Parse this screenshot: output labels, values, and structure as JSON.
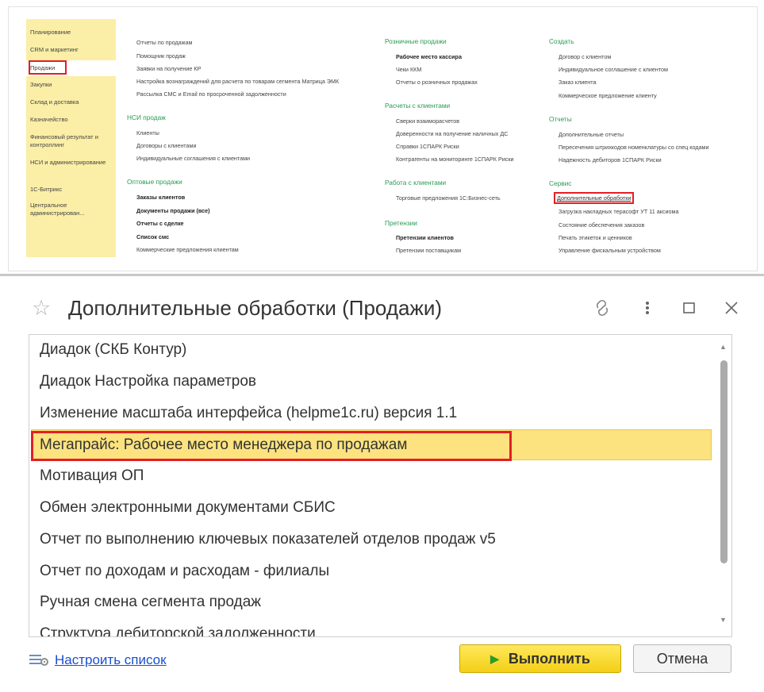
{
  "sidebar": {
    "items": [
      "Планирование",
      "CRM и маркетинг",
      "Продажи",
      "Закупки",
      "Склад и доставка",
      "Казначейство",
      "Финансовый результат и контроллинг",
      "НСИ и администрирование",
      "1С-Битрикс",
      "Центральное администрирован..."
    ]
  },
  "col1": {
    "links": [
      "Отчеты по продажам",
      "Помощник продаж",
      "Заявки на получение КР",
      "Настройка вознаграждений для расчета по товарам сегмента Матрица ЭМК",
      "Рассылка СМС и Email по просроченной задолженности"
    ],
    "nsi_title": "НСИ продаж",
    "nsi_links": [
      "Клиенты",
      "Договоры с клиентами",
      "Индивидуальные соглашения с клиентами"
    ],
    "opt_title": "Оптовые продажи",
    "opt_links": [
      "Заказы клиентов",
      "Документы продажи (все)",
      "Отчеты с сделке",
      "Список смс",
      "Коммерческие предложения клиентам"
    ]
  },
  "col2": {
    "retail_title": "Розничные продажи",
    "retail_links": [
      "Рабочее место кассира",
      "Чеки ККМ",
      "Отчеты о розничных продажах"
    ],
    "calc_title": "Расчеты с клиентами",
    "calc_links": [
      "Сверки взаиморасчетов",
      "Доверенности на получение наличных ДС",
      "Справки 1СПАРК Риски",
      "Контрагенты на мониторинге 1СПАРК Риски"
    ],
    "work_title": "Работа с клиентами",
    "work_links": [
      "Торговые предложения 1С:Бизнес-сеть"
    ],
    "claims_title": "Претензии",
    "claims_links": [
      "Претензии клиентов",
      "Претензии поставщикам"
    ]
  },
  "col3": {
    "create_title": "Создать",
    "create_links": [
      "Договор с клиентом",
      "Индивидуальное соглашение с клиентом",
      "Заказ клиента",
      "Коммерческое предложение клиенту"
    ],
    "reports_title": "Отчеты",
    "reports_links": [
      "Дополнительные отчеты",
      "Пересечения штрихкодов номенклатуры со спец кодами",
      "Надежность дебиторов 1СПАРК Риски"
    ],
    "service_title": "Сервис",
    "service_links": [
      "Дополнительные обработки",
      "Загрузка накладных терасофт УТ 11 аксиома",
      "Состояние обеспечения заказов",
      "Печать этикеток и ценников",
      "Управление фискальным устройством"
    ]
  },
  "dialog": {
    "title": "Дополнительные обработки (Продажи)",
    "items": [
      "Диадок (СКБ Контур)",
      "Диадок Настройка параметров",
      "Изменение масштаба интерфейса (helpme1c.ru) версия 1.1",
      "Мегапрайс: Рабочее место менеджера по продажам",
      "Мотивация ОП",
      "Обмен электронными документами СБИС",
      "Отчет по выполнению ключевых показателей отделов продаж v5",
      "Отчет по доходам и расходам - филиалы",
      "Ручная смена сегмента продаж",
      "Структура дебиторской задолженности"
    ],
    "configure_label": "Настроить список",
    "run_label": "Выполнить",
    "cancel_label": "Отмена"
  },
  "colors": {
    "accent_yellow": "#fce37f",
    "sidebar_bg": "#fbeea6",
    "section_green": "#2a9a55",
    "highlight_red": "#e31e24",
    "link_blue": "#1a4fd0"
  }
}
